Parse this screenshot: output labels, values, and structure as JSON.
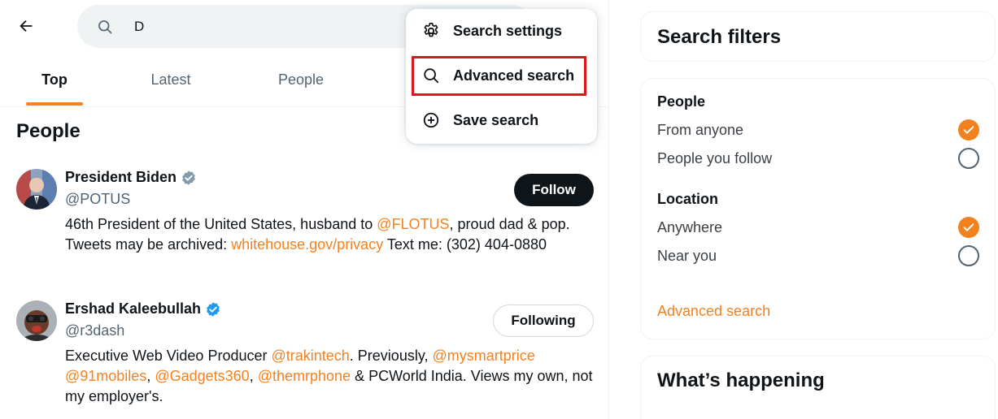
{
  "search": {
    "query": "D"
  },
  "tabs": [
    {
      "label": "Top"
    },
    {
      "label": "Latest"
    },
    {
      "label": "People"
    }
  ],
  "section_title": "People",
  "users": [
    {
      "name": "President Biden",
      "handle": "@POTUS",
      "button": "Follow",
      "bio": {
        "t1": "46th President of the United States, husband to ",
        "l1": "@FLOTUS",
        "t2": ", proud dad & pop. Tweets may be archived: ",
        "l2": "whitehouse.gov/privacy",
        "t3": " Text me: (302) 404-0880"
      }
    },
    {
      "name": "Ershad Kaleebullah",
      "handle": "@r3dash",
      "button": "Following",
      "bio": {
        "t1": "Executive Web Video Producer ",
        "l1": "@trakintech",
        "t2": ". Previously, ",
        "l2": "@mysmartprice",
        "t3": " ",
        "l3": "@91mobiles",
        "t4": ", ",
        "l4": "@Gadgets360",
        "t5": ", ",
        "l5": "@themrphone",
        "t6": " & PCWorld India. Views my own, not my employer's."
      }
    }
  ],
  "menu": {
    "items": [
      {
        "label": "Search settings",
        "icon": "gear-icon"
      },
      {
        "label": "Advanced search",
        "icon": "search-icon"
      },
      {
        "label": "Save search",
        "icon": "plus-circle-icon"
      }
    ]
  },
  "filters": {
    "title": "Search filters",
    "people_heading": "People",
    "people_options": [
      {
        "label": "From anyone",
        "checked": true
      },
      {
        "label": "People you follow",
        "checked": false
      }
    ],
    "location_heading": "Location",
    "location_options": [
      {
        "label": "Anywhere",
        "checked": true
      },
      {
        "label": "Near you",
        "checked": false
      }
    ],
    "advanced_link": "Advanced search"
  },
  "trending": {
    "title": "What’s happening"
  },
  "colors": {
    "accent": "#f4811f",
    "highlight": "#e0141e",
    "verified_gray": "#829aab",
    "verified_blue": "#1d9bf0"
  }
}
